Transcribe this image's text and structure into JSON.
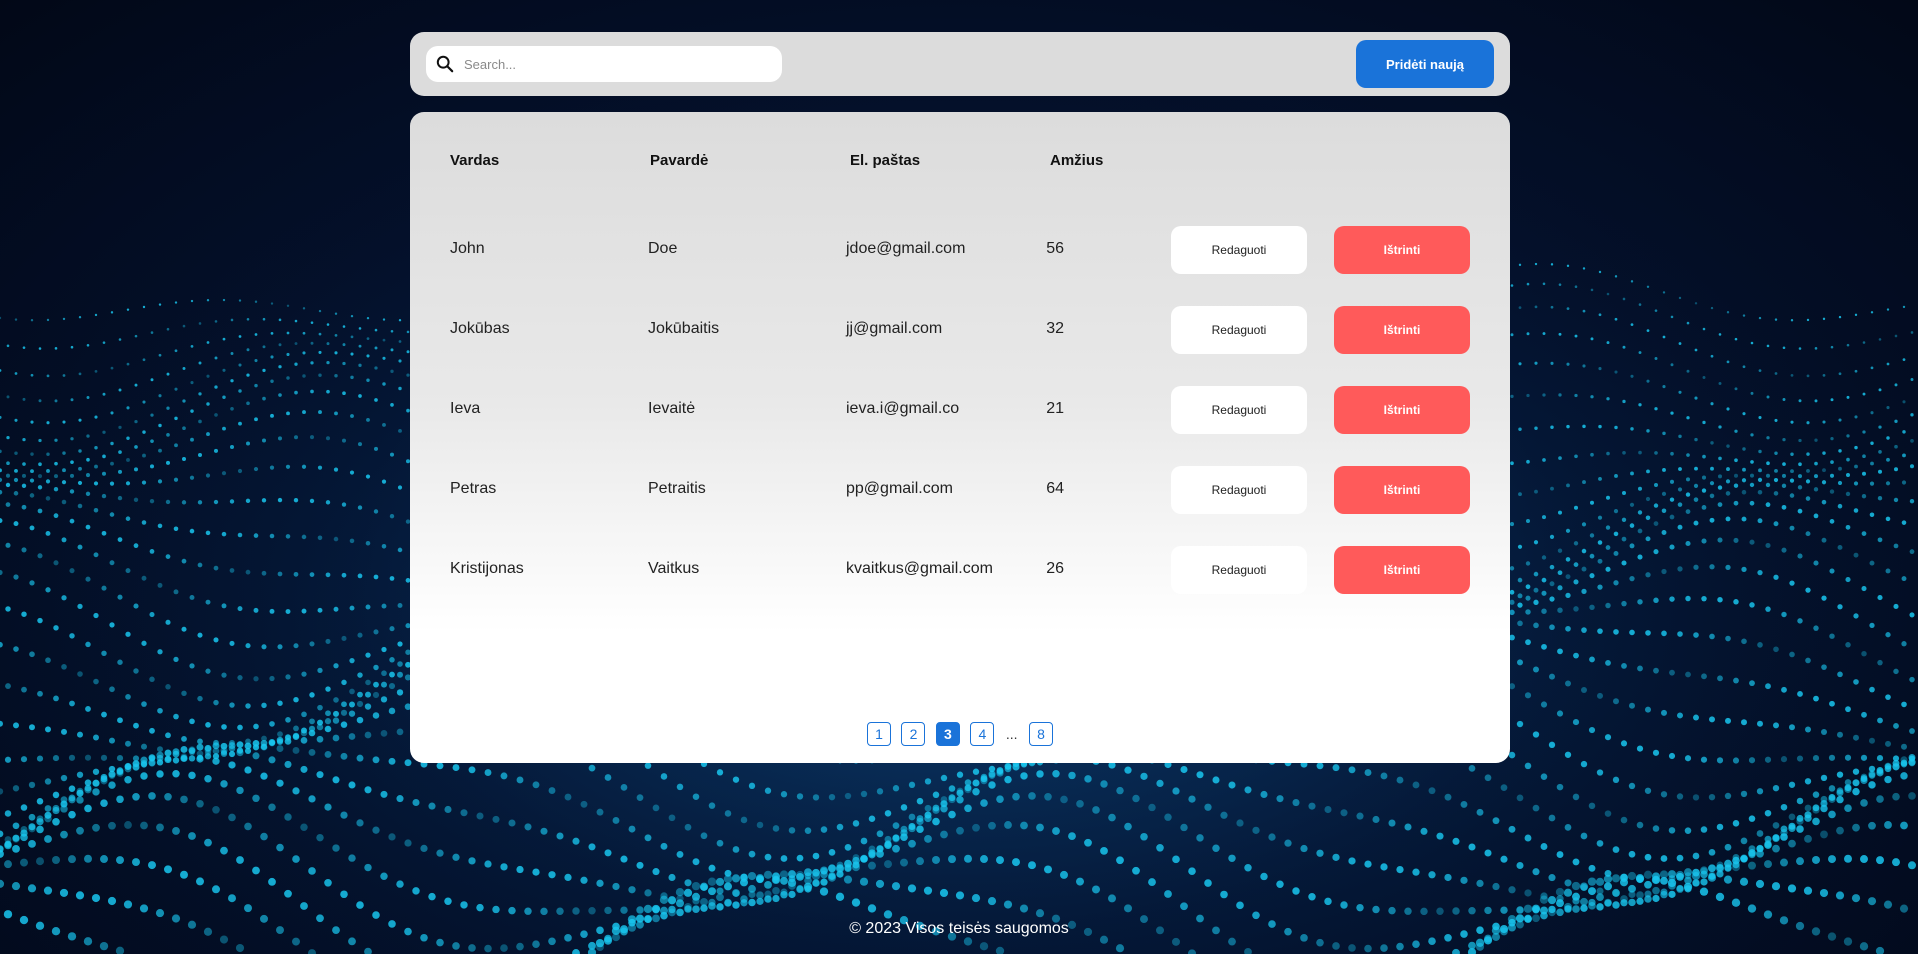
{
  "search": {
    "placeholder": "Search..."
  },
  "toolbar": {
    "add_label": "Pridėti naują"
  },
  "table": {
    "headers": [
      "Vardas",
      "Pavardė",
      "El. paštas",
      "Amžius"
    ],
    "rows": [
      {
        "first": "John",
        "last": "Doe",
        "email": "jdoe@gmail.com",
        "age": "56",
        "edit": "Redaguoti",
        "delete": "Ištrinti"
      },
      {
        "first": "Jokūbas",
        "last": "Jokūbaitis",
        "email": "jj@gmail.com",
        "age": "32",
        "edit": "Redaguoti",
        "delete": "Ištrinti"
      },
      {
        "first": "Ieva",
        "last": "Ievaitė",
        "email": "ieva.i@gmail.co",
        "age": "21",
        "edit": "Redaguoti",
        "delete": "Ištrinti"
      },
      {
        "first": "Petras",
        "last": "Petraitis",
        "email": "pp@gmail.com",
        "age": "64",
        "edit": "Redaguoti",
        "delete": "Ištrinti"
      },
      {
        "first": "Kristijonas",
        "last": "Vaitkus",
        "email": "kvaitkus@gmail.com",
        "age": "26",
        "edit": "Redaguoti",
        "delete": "Ištrinti"
      }
    ]
  },
  "pagination": {
    "pages": [
      "1",
      "2",
      "3",
      "4"
    ],
    "active": "3",
    "ellipsis": "...",
    "last": "8"
  },
  "footer": {
    "text": "© 2023 Visos teisės saugomos"
  },
  "colors": {
    "accent": "#1a73d9",
    "danger": "#ff5a5a",
    "panel": "#dcdcdc"
  },
  "icons": {
    "search": "search-icon",
    "background": "particle-wave-background"
  }
}
